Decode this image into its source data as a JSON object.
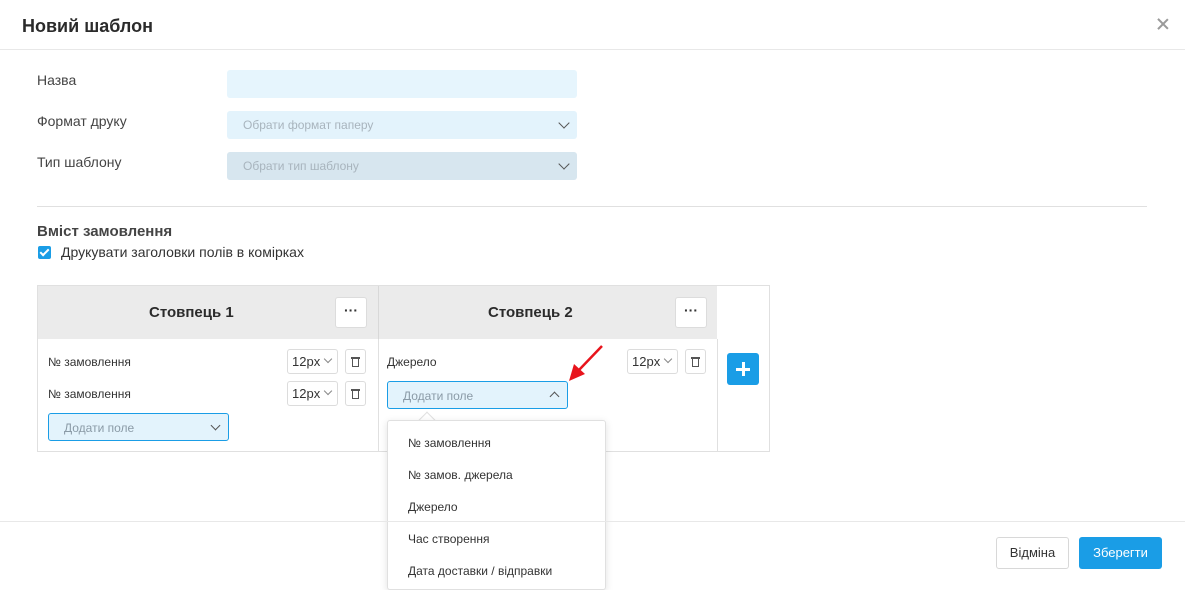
{
  "dialog": {
    "title": "Новий шаблон"
  },
  "form": {
    "name_label": "Назва",
    "name_value": "",
    "print_format_label": "Формат друку",
    "print_format_placeholder": "Обрати формат паперу",
    "template_type_label": "Тип шаблону",
    "template_type_placeholder": "Обрати тип шаблону"
  },
  "content": {
    "title": "Вміст замовлення",
    "print_headers_label": "Друкувати заголовки полів в комірках",
    "print_headers_checked": true
  },
  "columns": [
    {
      "title": "Стовпець 1",
      "more_label": "···",
      "fields": [
        {
          "label": "№ замовлення",
          "size": "12px"
        },
        {
          "label": "№ замовлення",
          "size": "12px"
        }
      ],
      "add_field_placeholder": "Додати поле"
    },
    {
      "title": "Стовпець 2",
      "more_label": "···",
      "fields": [
        {
          "label": "Джерело",
          "size": "12px"
        }
      ],
      "add_field_placeholder": "Додати поле"
    }
  ],
  "field_options": [
    "№ замовлення",
    "№ замов. джерела",
    "Джерело",
    "Час створення",
    "Дата доставки / відправки"
  ],
  "footer": {
    "cancel_label": "Відміна",
    "save_label": "Зберегти"
  },
  "colors": {
    "accent": "#1a9de6",
    "annotation_arrow": "#e8141c"
  }
}
